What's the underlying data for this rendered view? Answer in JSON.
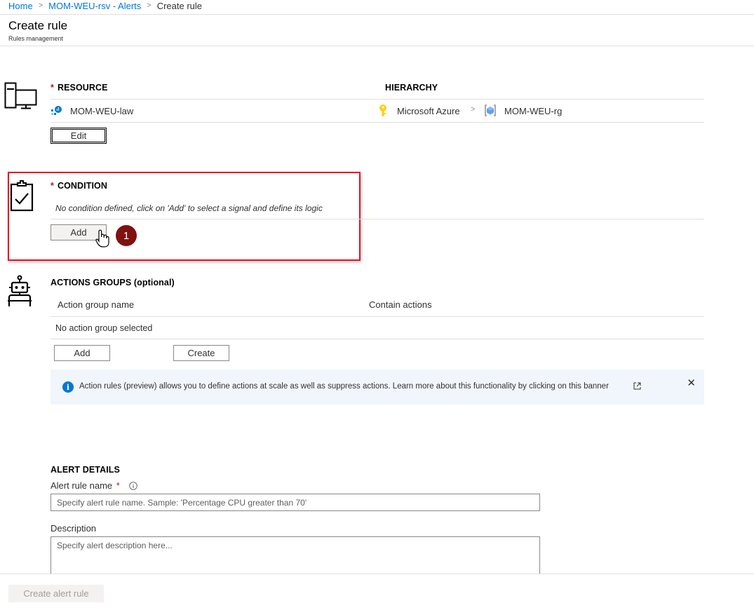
{
  "breadcrumb": {
    "home": "Home",
    "parent": "MOM-WEU-rsv - Alerts",
    "current": "Create rule",
    "separator": ">"
  },
  "page": {
    "title": "Create rule",
    "subtitle": "Rules management"
  },
  "resource": {
    "icon": "computer-monitor-icon",
    "label": "RESOURCE",
    "required_mark": "*",
    "hierarchy_label": "HIERARCHY",
    "name": "MOM-WEU-law",
    "hierarchy": {
      "subscription": "Microsoft Azure",
      "separator": ">",
      "resource_group": "MOM-WEU-rg"
    },
    "edit_label": "Edit"
  },
  "condition": {
    "icon": "clipboard-check-icon",
    "label": "CONDITION",
    "required_mark": "*",
    "empty_text": "No condition defined, click on 'Add' to select a signal and define its logic",
    "add_label": "Add",
    "step_badge": "1"
  },
  "actions": {
    "icon": "robot-icon",
    "label": "ACTIONS GROUPS (optional)",
    "columns": [
      "Action group name",
      "Contain actions"
    ],
    "empty_text": "No action group selected",
    "add_label": "Add",
    "create_label": "Create"
  },
  "banner": {
    "info_glyph": "i",
    "text": "Action rules (preview) allows you to define actions at scale as well as suppress actions. Learn more about this functionality by clicking on this banner",
    "close_glyph": "✕"
  },
  "alert_details": {
    "label": "ALERT DETAILS",
    "rule_name_label": "Alert rule name",
    "required_mark": "*",
    "rule_name_placeholder": "Specify alert rule name. Sample: 'Percentage CPU greater than 70'",
    "description_label": "Description",
    "description_placeholder": "Specify alert description here..."
  },
  "footer": {
    "create_label": "Create alert rule"
  },
  "colors": {
    "accent": "#0078d4",
    "required": "#c50f1f",
    "highlight_box": "#e81123",
    "badge": "#7f1110",
    "banner_bg": "#f0f6fc"
  }
}
